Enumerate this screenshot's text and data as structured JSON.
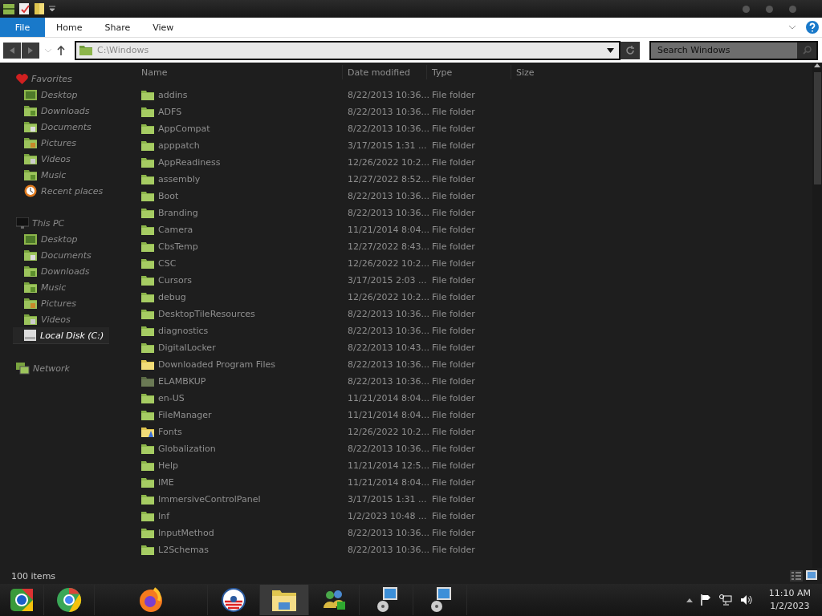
{
  "ribbon": {
    "tabs": [
      {
        "label": "File",
        "selected": true
      },
      {
        "label": "Home",
        "selected": false
      },
      {
        "label": "Share",
        "selected": false
      },
      {
        "label": "View",
        "selected": false
      }
    ]
  },
  "address": {
    "value": "C:\\Windows"
  },
  "search": {
    "placeholder": "Search Windows"
  },
  "sidebar": {
    "groups": [
      {
        "label": "Favorites",
        "kind": "favorites",
        "items": [
          {
            "label": "Desktop",
            "kind": "desktop",
            "selected": false
          },
          {
            "label": "Downloads",
            "kind": "downloads",
            "selected": false
          },
          {
            "label": "Documents",
            "kind": "documents",
            "selected": false
          },
          {
            "label": "Pictures",
            "kind": "pictures",
            "selected": false
          },
          {
            "label": "Videos",
            "kind": "videos",
            "selected": false
          },
          {
            "label": "Music",
            "kind": "music",
            "selected": false
          },
          {
            "label": "Recent places",
            "kind": "recent",
            "selected": false
          }
        ]
      },
      {
        "label": "This PC",
        "kind": "pc",
        "items": [
          {
            "label": "Desktop",
            "kind": "desktop",
            "selected": false
          },
          {
            "label": "Documents",
            "kind": "documents",
            "selected": false
          },
          {
            "label": "Downloads",
            "kind": "downloads",
            "selected": false
          },
          {
            "label": "Music",
            "kind": "music",
            "selected": false
          },
          {
            "label": "Pictures",
            "kind": "pictures",
            "selected": false
          },
          {
            "label": "Videos",
            "kind": "videos",
            "selected": false
          },
          {
            "label": "Local Disk (C:)",
            "kind": "disk",
            "selected": true
          }
        ]
      },
      {
        "label": "Network",
        "kind": "network"
      }
    ]
  },
  "table": {
    "columns": [
      "Name",
      "Date modified",
      "Type",
      "Size"
    ],
    "rows": [
      {
        "name": "addins",
        "date": "8/22/2013 10:36...",
        "type": "File folder",
        "kind": "folder"
      },
      {
        "name": "ADFS",
        "date": "8/22/2013 10:36...",
        "type": "File folder",
        "kind": "folder"
      },
      {
        "name": "AppCompat",
        "date": "8/22/2013 10:36...",
        "type": "File folder",
        "kind": "folder"
      },
      {
        "name": "apppatch",
        "date": "3/17/2015 1:31 ...",
        "type": "File folder",
        "kind": "folder"
      },
      {
        "name": "AppReadiness",
        "date": "12/26/2022 10:2...",
        "type": "File folder",
        "kind": "folder"
      },
      {
        "name": "assembly",
        "date": "12/27/2022 8:52...",
        "type": "File folder",
        "kind": "folder"
      },
      {
        "name": "Boot",
        "date": "8/22/2013 10:36...",
        "type": "File folder",
        "kind": "folder"
      },
      {
        "name": "Branding",
        "date": "8/22/2013 10:36...",
        "type": "File folder",
        "kind": "folder"
      },
      {
        "name": "Camera",
        "date": "11/21/2014 8:04...",
        "type": "File folder",
        "kind": "folder"
      },
      {
        "name": "CbsTemp",
        "date": "12/27/2022 8:43...",
        "type": "File folder",
        "kind": "folder"
      },
      {
        "name": "CSC",
        "date": "12/26/2022 10:2...",
        "type": "File folder",
        "kind": "folder"
      },
      {
        "name": "Cursors",
        "date": "3/17/2015 2:03 ...",
        "type": "File folder",
        "kind": "folder"
      },
      {
        "name": "debug",
        "date": "12/26/2022 10:2...",
        "type": "File folder",
        "kind": "folder"
      },
      {
        "name": "DesktopTileResources",
        "date": "8/22/2013 10:36...",
        "type": "File folder",
        "kind": "folder"
      },
      {
        "name": "diagnostics",
        "date": "8/22/2013 10:36...",
        "type": "File folder",
        "kind": "folder"
      },
      {
        "name": "DigitalLocker",
        "date": "8/22/2013 10:43...",
        "type": "File folder",
        "kind": "folder"
      },
      {
        "name": "Downloaded Program Files",
        "date": "8/22/2013 10:36...",
        "type": "File folder",
        "kind": "system"
      },
      {
        "name": "ELAMBKUP",
        "date": "8/22/2013 10:36...",
        "type": "File folder",
        "kind": "hidden"
      },
      {
        "name": "en-US",
        "date": "11/21/2014 8:04...",
        "type": "File folder",
        "kind": "folder"
      },
      {
        "name": "FileManager",
        "date": "11/21/2014 8:04...",
        "type": "File folder",
        "kind": "folder"
      },
      {
        "name": "Fonts",
        "date": "12/26/2022 10:2...",
        "type": "File folder",
        "kind": "fonts"
      },
      {
        "name": "Globalization",
        "date": "8/22/2013 10:36...",
        "type": "File folder",
        "kind": "folder"
      },
      {
        "name": "Help",
        "date": "11/21/2014 12:5...",
        "type": "File folder",
        "kind": "folder"
      },
      {
        "name": "IME",
        "date": "11/21/2014 8:04...",
        "type": "File folder",
        "kind": "folder"
      },
      {
        "name": "ImmersiveControlPanel",
        "date": "3/17/2015 1:31 ...",
        "type": "File folder",
        "kind": "folder"
      },
      {
        "name": "Inf",
        "date": "1/2/2023 10:48 ...",
        "type": "File folder",
        "kind": "folder"
      },
      {
        "name": "InputMethod",
        "date": "8/22/2013 10:36...",
        "type": "File folder",
        "kind": "folder"
      },
      {
        "name": "L2Schemas",
        "date": "8/22/2013 10:36...",
        "type": "File folder",
        "kind": "folder"
      }
    ]
  },
  "status_bar": {
    "count": "100 items"
  },
  "clock": {
    "time": "11:10 AM",
    "date": "1/2/2023"
  }
}
